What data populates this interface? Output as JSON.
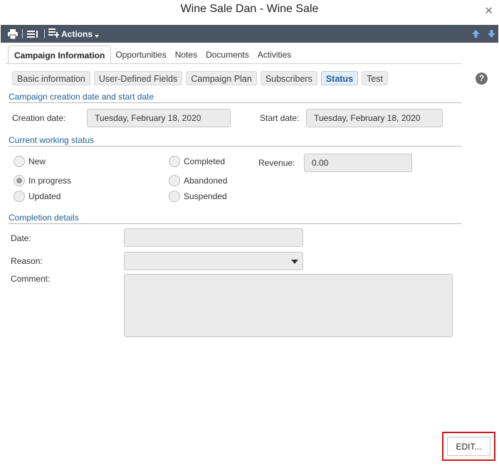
{
  "window": {
    "title": "Wine Sale Dan - Wine Sale"
  },
  "toolbar": {
    "actions_label": "Actions"
  },
  "tabs": [
    {
      "label": "Campaign Information",
      "active": true
    },
    {
      "label": "Opportunities",
      "active": false
    },
    {
      "label": "Notes",
      "active": false
    },
    {
      "label": "Documents",
      "active": false
    },
    {
      "label": "Activities",
      "active": false
    }
  ],
  "subtabs": [
    {
      "label": "Basic information",
      "active": false
    },
    {
      "label": "User-Defined Fields",
      "active": false
    },
    {
      "label": "Campaign Plan",
      "active": false
    },
    {
      "label": "Subscribers",
      "active": false
    },
    {
      "label": "Status",
      "active": true
    },
    {
      "label": "Test",
      "active": false
    }
  ],
  "help_glyph": "?",
  "dates_section": {
    "heading": "Campaign creation date and start date",
    "creation_label": "Creation date:",
    "creation_value": "Tuesday, February 18, 2020",
    "start_label": "Start date:",
    "start_value": "Tuesday, February 18, 2020"
  },
  "status_section": {
    "heading": "Current working status",
    "options": {
      "new": "New",
      "in_progress": "In progress",
      "updated": "Updated",
      "completed": "Completed",
      "abandoned": "Abandoned",
      "suspended": "Suspended"
    },
    "selected": "In progress",
    "revenue_label": "Revenue:",
    "revenue_value": "0.00"
  },
  "completion_section": {
    "heading": "Completion details",
    "date_label": "Date:",
    "date_value": "",
    "reason_label": "Reason:",
    "reason_value": "",
    "comment_label": "Comment:",
    "comment_value": ""
  },
  "footer": {
    "edit_label": "EDIT..."
  }
}
